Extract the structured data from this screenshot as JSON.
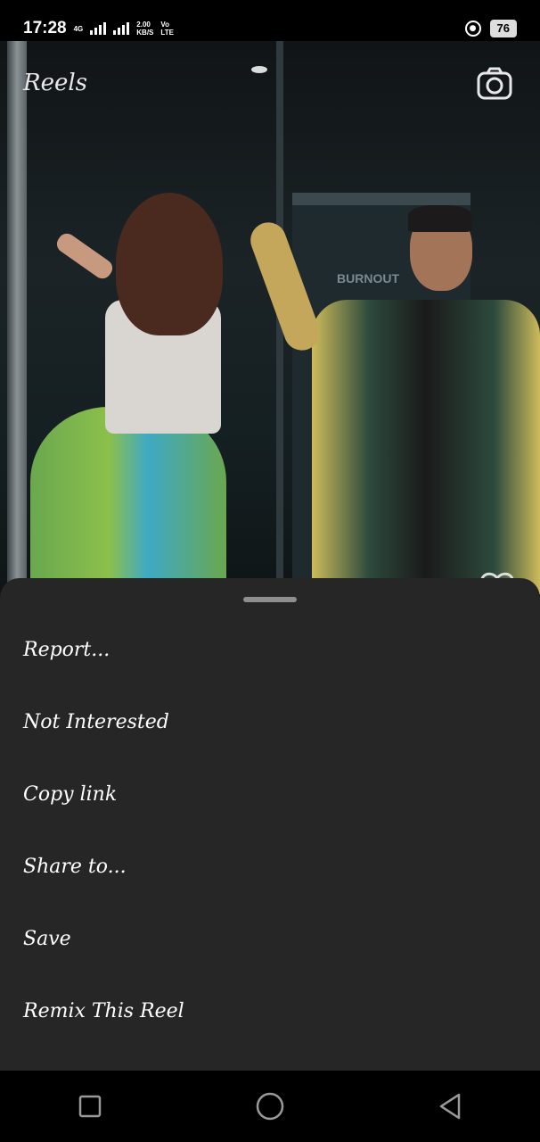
{
  "status_bar": {
    "time": "17:28",
    "network_top": "4G",
    "speed_value": "2.00",
    "speed_unit": "KB/S",
    "volte_top": "Vo",
    "volte_bottom": "LTE",
    "battery": "76"
  },
  "header": {
    "title": "Reels",
    "camera_icon": "camera-icon"
  },
  "video": {
    "sign_text": "BURNOUT"
  },
  "sheet": {
    "menu": [
      {
        "label": "Report..."
      },
      {
        "label": "Not Interested"
      },
      {
        "label": "Copy link"
      },
      {
        "label": "Share to..."
      },
      {
        "label": "Save"
      },
      {
        "label": "Remix This Reel"
      }
    ]
  },
  "navbar": {
    "recent_icon": "square-icon",
    "home_icon": "circle-icon",
    "back_icon": "triangle-back-icon"
  },
  "colors": {
    "sheet_bg": "#262626",
    "handle": "#8e8e8e",
    "text": "#ffffff"
  }
}
